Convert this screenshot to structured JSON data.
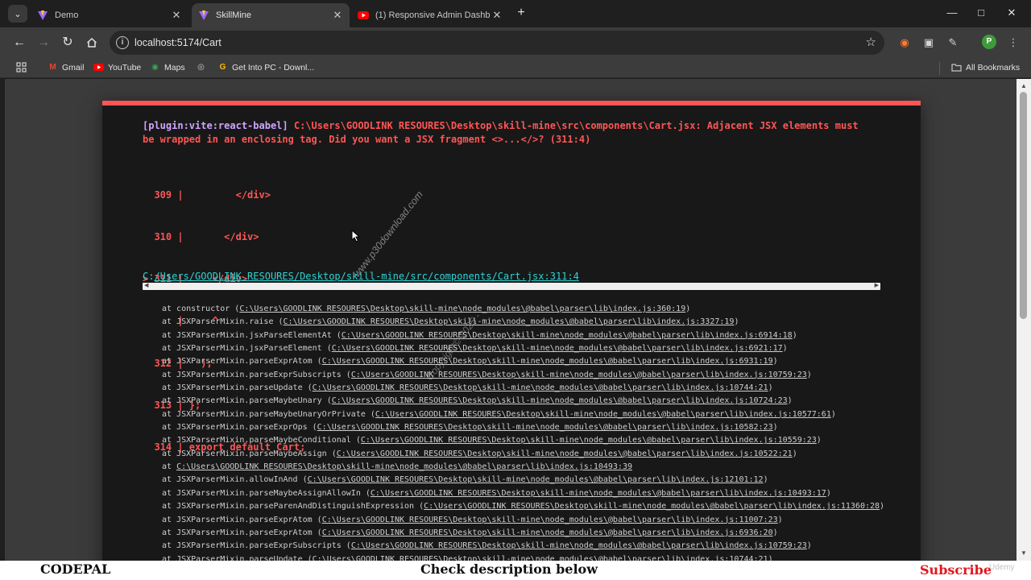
{
  "tabs": [
    {
      "title": "Demo",
      "active": false
    },
    {
      "title": "SkillMine",
      "active": true
    },
    {
      "title": "(1) Responsive Admin Dashboa",
      "active": false
    }
  ],
  "toolbar": {
    "url": "localhost:5174/Cart",
    "profile_initial": "P"
  },
  "bookmarks": {
    "items": [
      "Gmail",
      "YouTube",
      "Maps",
      "Get Into PC - Downl..."
    ],
    "all_bookmarks": "All Bookmarks"
  },
  "error": {
    "plugin": "[plugin:vite:react-babel]",
    "message_line1": "C:\\Users\\GOODLINK RESOURES\\Desktop\\skill-mine\\src\\components\\Cart.jsx: Adjacent JSX elements must",
    "message_line2": "be wrapped in an enclosing tag. Did you want a JSX fragment <>...</>? (311:4)",
    "frame_lines": [
      "  309 |         </div>",
      "  310 |       </div>",
      "> 311 |     </div>",
      "      |     ^",
      "  312 |   );",
      "  313 | };",
      "  314 | export default Cart;"
    ],
    "file_prefix": "C:",
    "file_path": "/Users/GOODLINK RESOURES/Desktop/skill-mine/src/components/Cart.jsx:311:4",
    "stack": [
      [
        "at constructor (",
        "C:\\Users\\GOODLINK RESOURES\\Desktop\\skill-mine\\node_modules\\@babel\\parser\\lib\\index.js:360:19",
        ")"
      ],
      [
        "at JSXParserMixin.raise (",
        "C:\\Users\\GOODLINK RESOURES\\Desktop\\skill-mine\\node_modules\\@babel\\parser\\lib\\index.js:3327:19",
        ")"
      ],
      [
        "at JSXParserMixin.jsxParseElementAt (",
        "C:\\Users\\GOODLINK RESOURES\\Desktop\\skill-mine\\node_modules\\@babel\\parser\\lib\\index.js:6914:18",
        ")"
      ],
      [
        "at JSXParserMixin.jsxParseElement (",
        "C:\\Users\\GOODLINK RESOURES\\Desktop\\skill-mine\\node_modules\\@babel\\parser\\lib\\index.js:6921:17",
        ")"
      ],
      [
        "at JSXParserMixin.parseExprAtom (",
        "C:\\Users\\GOODLINK RESOURES\\Desktop\\skill-mine\\node_modules\\@babel\\parser\\lib\\index.js:6931:19",
        ")"
      ],
      [
        "at JSXParserMixin.parseExprSubscripts (",
        "C:\\Users\\GOODLINK RESOURES\\Desktop\\skill-mine\\node_modules\\@babel\\parser\\lib\\index.js:10759:23",
        ")"
      ],
      [
        "at JSXParserMixin.parseUpdate (",
        "C:\\Users\\GOODLINK RESOURES\\Desktop\\skill-mine\\node_modules\\@babel\\parser\\lib\\index.js:10744:21",
        ")"
      ],
      [
        "at JSXParserMixin.parseMaybeUnary (",
        "C:\\Users\\GOODLINK RESOURES\\Desktop\\skill-mine\\node_modules\\@babel\\parser\\lib\\index.js:10724:23",
        ")"
      ],
      [
        "at JSXParserMixin.parseMaybeUnaryOrPrivate (",
        "C:\\Users\\GOODLINK RESOURES\\Desktop\\skill-mine\\node_modules\\@babel\\parser\\lib\\index.js:10577:61",
        ")"
      ],
      [
        "at JSXParserMixin.parseExprOps (",
        "C:\\Users\\GOODLINK RESOURES\\Desktop\\skill-mine\\node_modules\\@babel\\parser\\lib\\index.js:10582:23",
        ")"
      ],
      [
        "at JSXParserMixin.parseMaybeConditional (",
        "C:\\Users\\GOODLINK RESOURES\\Desktop\\skill-mine\\node_modules\\@babel\\parser\\lib\\index.js:10559:23",
        ")"
      ],
      [
        "at JSXParserMixin.parseMaybeAssign (",
        "C:\\Users\\GOODLINK RESOURES\\Desktop\\skill-mine\\node_modules\\@babel\\parser\\lib\\index.js:10522:21",
        ")"
      ],
      [
        "at ",
        "C:\\Users\\GOODLINK RESOURES\\Desktop\\skill-mine\\node_modules\\@babel\\parser\\lib\\index.js:10493:39",
        ""
      ],
      [
        "at JSXParserMixin.allowInAnd (",
        "C:\\Users\\GOODLINK RESOURES\\Desktop\\skill-mine\\node_modules\\@babel\\parser\\lib\\index.js:12101:12",
        ")"
      ],
      [
        "at JSXParserMixin.parseMaybeAssignAllowIn (",
        "C:\\Users\\GOODLINK RESOURES\\Desktop\\skill-mine\\node_modules\\@babel\\parser\\lib\\index.js:10493:17",
        ")"
      ],
      [
        "at JSXParserMixin.parseParenAndDistinguishExpression (",
        "C:\\Users\\GOODLINK RESOURES\\Desktop\\skill-mine\\node_modules\\@babel\\parser\\lib\\index.js:11360:28",
        ")"
      ],
      [
        "at JSXParserMixin.parseExprAtom (",
        "C:\\Users\\GOODLINK RESOURES\\Desktop\\skill-mine\\node_modules\\@babel\\parser\\lib\\index.js:11007:23",
        ")"
      ],
      [
        "at JSXParserMixin.parseExprAtom (",
        "C:\\Users\\GOODLINK RESOURES\\Desktop\\skill-mine\\node_modules\\@babel\\parser\\lib\\index.js:6936:20",
        ")"
      ],
      [
        "at JSXParserMixin.parseExprSubscripts (",
        "C:\\Users\\GOODLINK RESOURES\\Desktop\\skill-mine\\node_modules\\@babel\\parser\\lib\\index.js:10759:23",
        ")"
      ],
      [
        "at JSXParserMixin.parseUpdate (",
        "C:\\Users\\GOODLINK RESOURES\\Desktop\\skill-mine\\node_modules\\@babel\\parser\\lib\\index.js:10744:21",
        ")"
      ]
    ]
  },
  "watermark": {
    "line1": "www.p30download.com",
    "line2": "Copyright© 2025 -"
  },
  "banner": {
    "left": "CODEPAL",
    "middle": "Check description below",
    "right": "Subscribe",
    "corner": "Udemy"
  },
  "colors": {
    "error_red": "#ff5555",
    "plugin_purple": "#cfa5ff",
    "link_cyan": "#2dd4d4",
    "subscribe_red": "#e0181e"
  }
}
